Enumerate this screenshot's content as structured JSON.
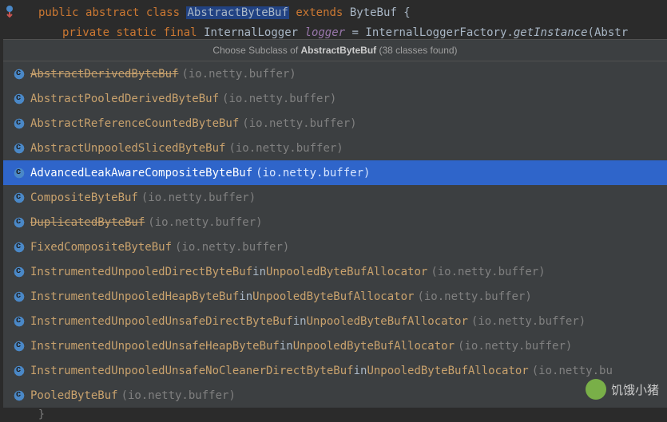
{
  "code": {
    "line1": {
      "kw_public": "public",
      "kw_abstract": "abstract",
      "kw_class": "class",
      "classname": "AbstractByteBuf",
      "kw_extends": "extends",
      "superclass": "ByteBuf",
      "brace": "{"
    },
    "line2": {
      "kw_private": "private",
      "kw_static": "static",
      "kw_final": "final",
      "type": "InternalLogger",
      "field": "logger",
      "eq": " = ",
      "factory": "InternalLoggerFactory.",
      "method": "getInstance",
      "rest": "(Abstr"
    }
  },
  "popup": {
    "title_prefix": "Choose Subclass of ",
    "title_class": "AbstractByteBuf",
    "title_suffix": " (38 classes found)"
  },
  "items": [
    {
      "name": "AbstractDerivedByteBuf",
      "pkg": "(io.netty.buffer)",
      "strike": true,
      "in": null
    },
    {
      "name": "AbstractPooledDerivedByteBuf",
      "pkg": "(io.netty.buffer)",
      "strike": false,
      "in": null
    },
    {
      "name": "AbstractReferenceCountedByteBuf",
      "pkg": "(io.netty.buffer)",
      "strike": false,
      "in": null
    },
    {
      "name": "AbstractUnpooledSlicedByteBuf",
      "pkg": "(io.netty.buffer)",
      "strike": false,
      "in": null
    },
    {
      "name": "AdvancedLeakAwareCompositeByteBuf",
      "pkg": "(io.netty.buffer)",
      "strike": false,
      "in": null,
      "selected": true
    },
    {
      "name": "CompositeByteBuf",
      "pkg": "(io.netty.buffer)",
      "strike": false,
      "in": null
    },
    {
      "name": "DuplicatedByteBuf",
      "pkg": "(io.netty.buffer)",
      "strike": true,
      "in": null
    },
    {
      "name": "FixedCompositeByteBuf",
      "pkg": "(io.netty.buffer)",
      "strike": false,
      "in": null
    },
    {
      "name": "InstrumentedUnpooledDirectByteBuf",
      "pkg": "(io.netty.buffer)",
      "strike": false,
      "in": "UnpooledByteBufAllocator"
    },
    {
      "name": "InstrumentedUnpooledHeapByteBuf",
      "pkg": "(io.netty.buffer)",
      "strike": false,
      "in": "UnpooledByteBufAllocator"
    },
    {
      "name": "InstrumentedUnpooledUnsafeDirectByteBuf",
      "pkg": "(io.netty.buffer)",
      "strike": false,
      "in": "UnpooledByteBufAllocator"
    },
    {
      "name": "InstrumentedUnpooledUnsafeHeapByteBuf",
      "pkg": "(io.netty.buffer)",
      "strike": false,
      "in": "UnpooledByteBufAllocator"
    },
    {
      "name": "InstrumentedUnpooledUnsafeNoCleanerDirectByteBuf",
      "pkg": "(io.netty.bu",
      "strike": false,
      "in": "UnpooledByteBufAllocator"
    },
    {
      "name": "PooledByteBuf",
      "pkg": "(io.netty.buffer)",
      "strike": false,
      "in": null
    }
  ],
  "watermark": "饥饿小猪",
  "closing_brace": "}"
}
